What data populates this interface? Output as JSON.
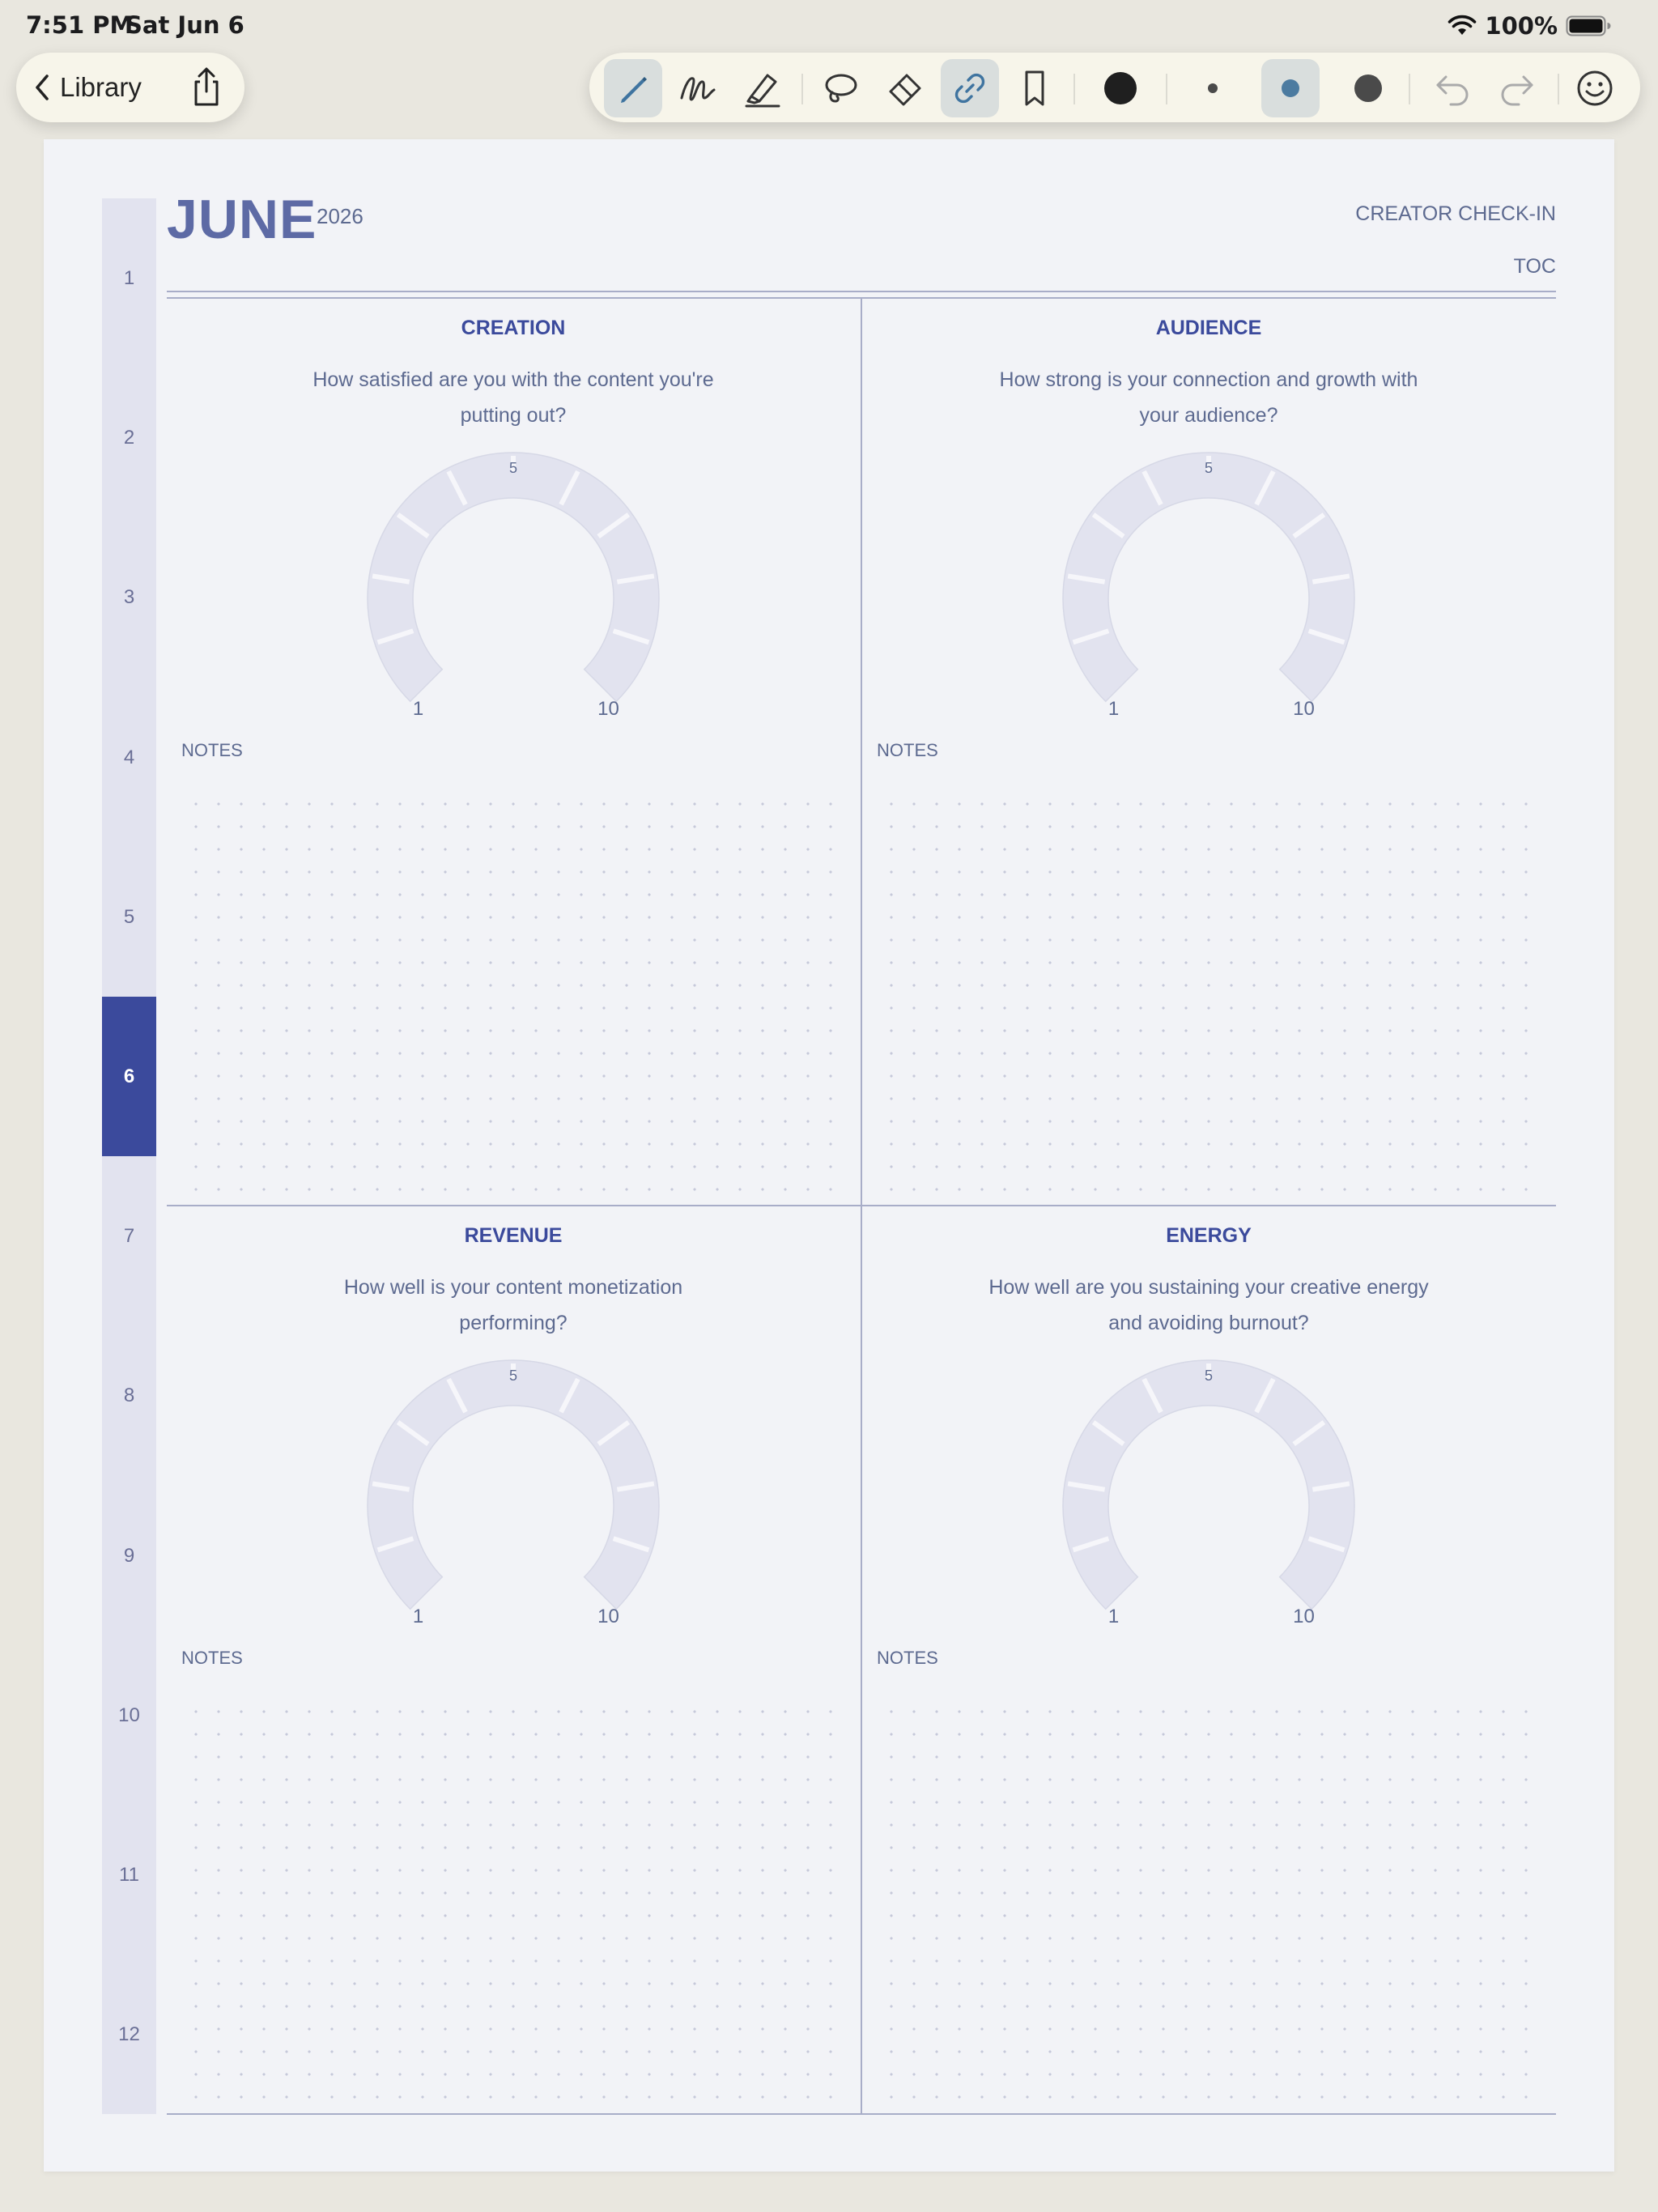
{
  "status_bar": {
    "time": "7:51 PM",
    "date": "Sat Jun 6",
    "battery": "100%"
  },
  "nav": {
    "back_label": "Library"
  },
  "toolbar": {
    "tools": [
      "pen-icon",
      "fountain-pen-icon",
      "highlighter-icon",
      "lasso-icon",
      "eraser-icon",
      "link-icon",
      "bookmark-icon"
    ],
    "selected_tool": "link-icon",
    "active_color": "#1f1f1f",
    "stroke_sizes": [
      "small",
      "medium",
      "large"
    ],
    "selected_stroke": "medium",
    "stroke_colors": {
      "small": "#4a4a4a",
      "medium": "#4c7ba0",
      "large": "#4a4a4a"
    }
  },
  "planner": {
    "month": "JUNE",
    "year": "2026",
    "label": "CREATOR CHECK-IN",
    "toc": "TOC",
    "months": [
      "1",
      "2",
      "3",
      "4",
      "5",
      "6",
      "7",
      "8",
      "9",
      "10",
      "11",
      "12"
    ],
    "active_month": "6",
    "sections": [
      {
        "title": "CREATION",
        "prompt": "How satisfied are you with the content you're putting out?",
        "scale_min": "1",
        "scale_mid": "5",
        "scale_max": "10",
        "notes_label": "NOTES"
      },
      {
        "title": "AUDIENCE",
        "prompt": "How strong is your connection and growth with your audience?",
        "scale_min": "1",
        "scale_mid": "5",
        "scale_max": "10",
        "notes_label": "NOTES"
      },
      {
        "title": "REVENUE",
        "prompt": "How well is your content monetization performing?",
        "scale_min": "1",
        "scale_mid": "5",
        "scale_max": "10",
        "notes_label": "NOTES"
      },
      {
        "title": "ENERGY",
        "prompt": "How well are you sustaining your creative energy and avoiding burnout?",
        "scale_min": "1",
        "scale_mid": "5",
        "scale_max": "10",
        "notes_label": "NOTES"
      }
    ]
  },
  "colors": {
    "accent": "#3b4a9c",
    "muted_text": "#5d6a90",
    "gauge_fill": "#e2e3ef",
    "page": "#f2f3f7"
  }
}
